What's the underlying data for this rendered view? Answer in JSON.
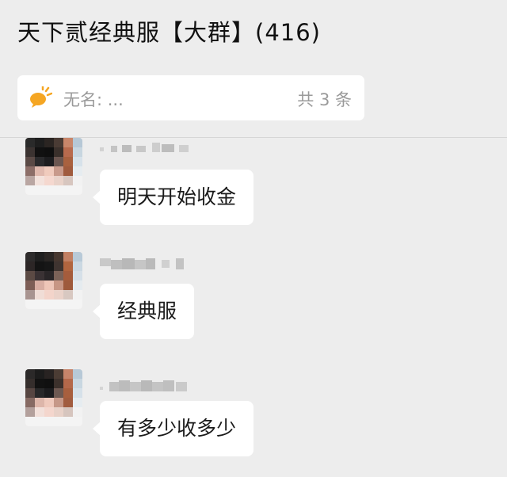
{
  "chat": {
    "title": "天下贰经典服【大群】(416)"
  },
  "notice": {
    "icon": "speech-bubble-icon",
    "text": "无名: ...",
    "count": "共 3 条",
    "icon_color": "#f5a623"
  },
  "messages": [
    {
      "text": "明天开始收金"
    },
    {
      "text": "经典服"
    },
    {
      "text": "有多少收多少"
    }
  ],
  "colors": {
    "background": "#ededed",
    "bubble": "#ffffff",
    "text": "#1a1a1a",
    "muted": "#9a9a9a"
  }
}
